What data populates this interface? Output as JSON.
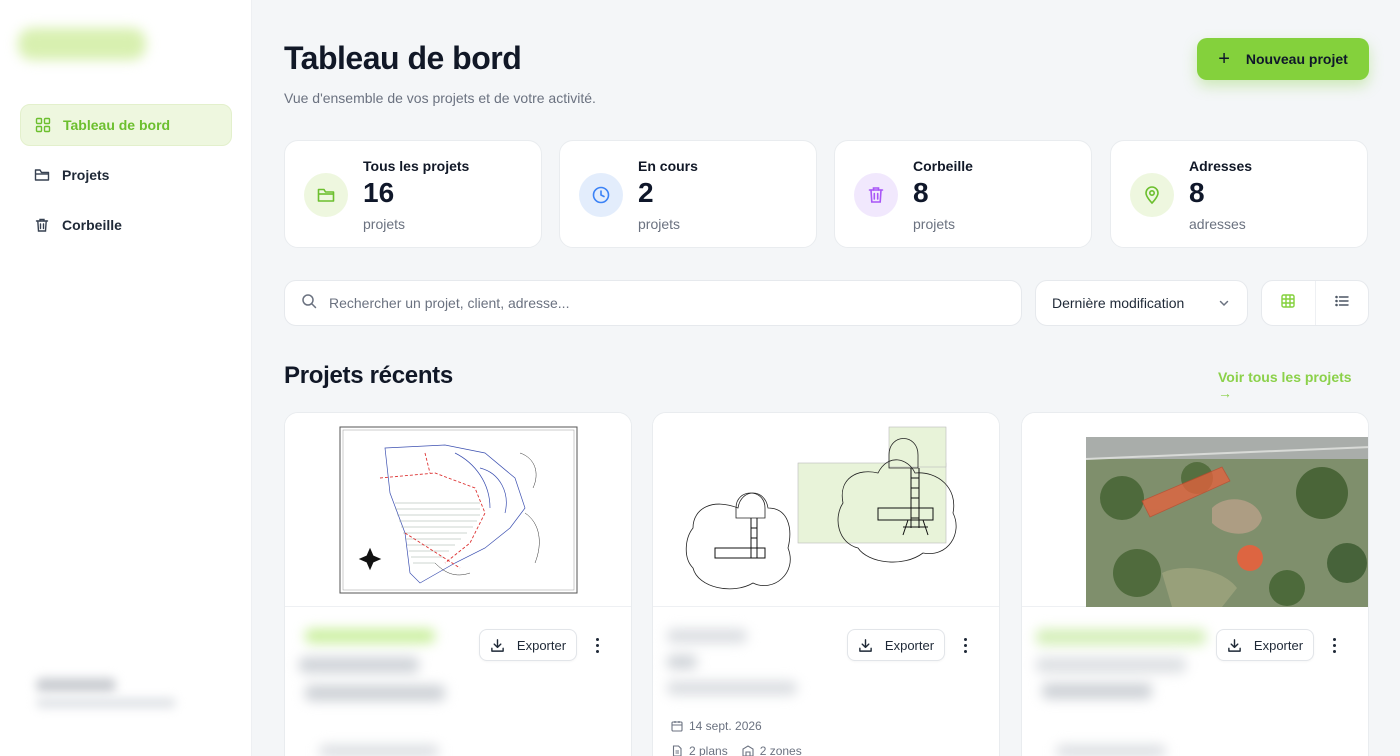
{
  "sidebar": {
    "items": [
      {
        "label": "Tableau de bord",
        "icon": "dashboard-grid-icon",
        "active": true
      },
      {
        "label": "Projets",
        "icon": "folder-icon",
        "active": false
      },
      {
        "label": "Corbeille",
        "icon": "trash-icon",
        "active": false
      }
    ]
  },
  "header": {
    "title": "Tableau de bord",
    "subtitle": "Vue d'ensemble de vos projets et de votre activité.",
    "new_project_label": "Nouveau projet"
  },
  "stats": [
    {
      "label": "Tous les projets",
      "value": "16",
      "unit": "projets",
      "icon": "folder-icon",
      "color": "#6cbf2e",
      "bg": "#eef7df"
    },
    {
      "label": "En cours",
      "value": "2",
      "unit": "projets",
      "icon": "clock-icon",
      "color": "#3b82f6",
      "bg": "#e3edfc"
    },
    {
      "label": "Corbeille",
      "value": "8",
      "unit": "projets",
      "icon": "trash-icon",
      "color": "#a855f7",
      "bg": "#f1e8fd"
    },
    {
      "label": "Adresses",
      "value": "8",
      "unit": "adresses",
      "icon": "map-pin-icon",
      "color": "#6cbf2e",
      "bg": "#eef7df"
    }
  ],
  "toolbar": {
    "search_placeholder": "Rechercher un projet, client, adresse...",
    "search_value": "",
    "sort_label": "Dernière modification",
    "view_modes": [
      "grid-view-icon",
      "list-view-icon"
    ],
    "active_view": "grid-view-icon"
  },
  "recent": {
    "title": "Projets récents",
    "see_all": "Voir tous les projets →",
    "cards": [
      {
        "thumbnail": "site-plan-drawing",
        "export_label": "Exporter"
      },
      {
        "thumbnail": "playground-floor-plan",
        "export_label": "Exporter",
        "date": "14 sept. 2026",
        "plans": "2 plans",
        "zones": "2 zones"
      },
      {
        "thumbnail": "aerial-map-view",
        "export_label": "Exporter"
      }
    ]
  },
  "colors": {
    "accent": "#84d13c",
    "accent_text": "#6cbf2e",
    "link": "#8bd14a"
  }
}
